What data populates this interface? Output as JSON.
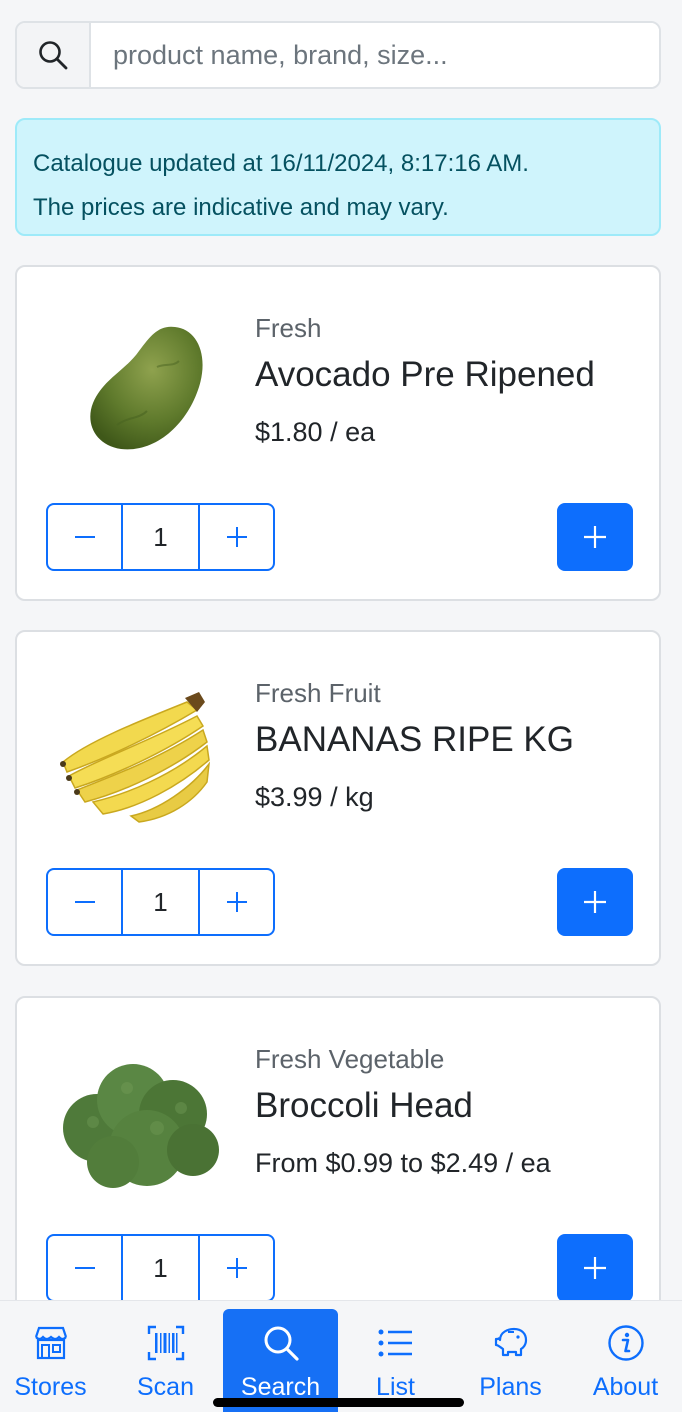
{
  "search": {
    "placeholder": "product name, brand, size...",
    "icon": "search-icon"
  },
  "notice": {
    "line1": "Catalogue updated at 16/11/2024, 8:17:16 AM.",
    "line2": "The prices are indicative and may vary."
  },
  "products": [
    {
      "category": "Fresh",
      "name": "Avocado Pre Ripened",
      "price": "$1.80 / ea",
      "quantity": "1",
      "image": "avocado"
    },
    {
      "category": "Fresh Fruit",
      "name": "BANANAS RIPE KG",
      "price": "$3.99 / kg",
      "quantity": "1",
      "image": "bananas"
    },
    {
      "category": "Fresh Vegetable",
      "name": "Broccoli Head",
      "price": "From $0.99 to $2.49 / ea",
      "quantity": "1",
      "image": "broccoli"
    }
  ],
  "tabs": [
    {
      "label": "Stores",
      "icon": "store-icon"
    },
    {
      "label": "Scan",
      "icon": "barcode-icon"
    },
    {
      "label": "Search",
      "icon": "search-icon",
      "active": true
    },
    {
      "label": "List",
      "icon": "list-icon"
    },
    {
      "label": "Plans",
      "icon": "piggy-bank-icon"
    },
    {
      "label": "About",
      "icon": "info-icon"
    }
  ],
  "colors": {
    "primary": "#0d6efd",
    "alert_bg": "#cff4fc",
    "alert_text": "#055160"
  }
}
